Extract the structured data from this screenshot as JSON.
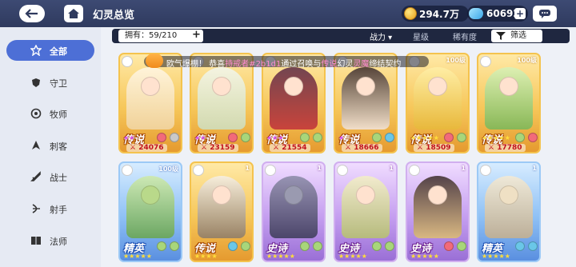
{
  "header": {
    "title": "幻灵总览",
    "gold": "294.7万",
    "gems": "60692"
  },
  "sidebar": {
    "items": [
      {
        "label": "全部",
        "icon": "all-icon",
        "active": true
      },
      {
        "label": "守卫",
        "icon": "shield-icon"
      },
      {
        "label": "牧师",
        "icon": "priest-icon"
      },
      {
        "label": "刺客",
        "icon": "assassin-icon"
      },
      {
        "label": "战士",
        "icon": "warrior-icon"
      },
      {
        "label": "射手",
        "icon": "archer-icon"
      },
      {
        "label": "法师",
        "icon": "mage-icon"
      }
    ]
  },
  "filters": {
    "owned": "拥有：59/210",
    "sort_power": "战力 ▾",
    "sort_star": "星级",
    "sort_rarity": "稀有度",
    "filter_label": "筛选"
  },
  "marquee": {
    "prefix": "欧气爆棚！ 恭喜",
    "player": "持戒者#2b1d1",
    "mid": "通过召唤与",
    "tag": "传说",
    "mid2": "幻灵",
    "name": "灵魔",
    "suffix": "缔结契约"
  },
  "cards_row1": [
    {
      "rarity": "传说",
      "level": "",
      "power": "24076",
      "stars_purple": 2,
      "color": "legend"
    },
    {
      "rarity": "传说",
      "level": "",
      "power": "23159",
      "stars_purple": 2,
      "color": "legend"
    },
    {
      "rarity": "传说",
      "level": "",
      "power": "21554",
      "stars_purple": 3,
      "color": "legend"
    },
    {
      "rarity": "传说",
      "level": "",
      "power": "18666",
      "stars_purple": 1,
      "color": "legend"
    },
    {
      "rarity": "传说",
      "level": "100级",
      "power": "18509",
      "stars_yellow": 5,
      "color": "legend"
    },
    {
      "rarity": "传说",
      "level": "100级",
      "power": "17780",
      "stars_yellow": 5,
      "color": "legend"
    }
  ],
  "cards_row2": [
    {
      "rarity": "精英",
      "level": "100级",
      "stars_yellow": 5,
      "color": "elite"
    },
    {
      "rarity": "传说",
      "level": "1",
      "stars_yellow": 4,
      "color": "legend"
    },
    {
      "rarity": "史诗",
      "level": "1",
      "stars_yellow": 5,
      "color": "epic"
    },
    {
      "rarity": "史诗",
      "level": "1",
      "stars_yellow": 5,
      "color": "epic"
    },
    {
      "rarity": "史诗",
      "level": "1",
      "stars_yellow": 5,
      "color": "epic"
    },
    {
      "rarity": "精英",
      "level": "1",
      "stars_yellow": 5,
      "color": "elite"
    }
  ]
}
